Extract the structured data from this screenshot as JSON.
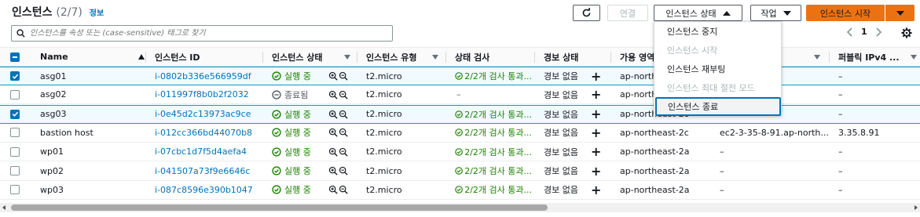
{
  "header": {
    "title": "인스턴스",
    "count": "(2/7)",
    "info_link": "정보"
  },
  "toolbar": {
    "connect_label": "연결",
    "instance_state_label": "인스턴스 상태",
    "actions_label": "작업",
    "launch_label": "인스턴스 시작"
  },
  "search": {
    "placeholder": "인스턴스를 속성 또는 (case-sensitive) 태그로 찾기"
  },
  "pagination": {
    "page": "1"
  },
  "columns": {
    "name": "Name",
    "instance_id": "인스턴스 ID",
    "state": "인스턴스 상태",
    "type": "인스턴스 유형",
    "status_check": "상태 검사",
    "alarm": "경보 상태",
    "az": "가용 영역",
    "dns": "S",
    "public_ip": "퍼블릭 IPv4 ..."
  },
  "rows": [
    {
      "name": "asg01",
      "id": "i-0802b336e566959df",
      "state": "실행 중",
      "state_kind": "running",
      "type": "t2.micro",
      "check": "2/2개 검사 통과...",
      "alarm": "경보 없음",
      "az": "ap-northeast-2a",
      "dns": "",
      "ip": "–",
      "selected": true
    },
    {
      "name": "asg02",
      "id": "i-011997f8b0b2f2032",
      "state": "종료됨",
      "state_kind": "terminated",
      "type": "t2.micro",
      "check": "–",
      "alarm": "경보 없음",
      "az": "ap-northeast-2a",
      "dns": "",
      "ip": "–",
      "selected": false
    },
    {
      "name": "asg03",
      "id": "i-0e45d2c13973ac9ce",
      "state": "실행 중",
      "state_kind": "running",
      "type": "t2.micro",
      "check": "2/2개 검사 통과...",
      "alarm": "경보 없음",
      "az": "ap-northeast-2c",
      "dns": "",
      "ip": "–",
      "selected": true
    },
    {
      "name": "bastion host",
      "id": "i-012cc366bd44070b8",
      "state": "실행 중",
      "state_kind": "running",
      "type": "t2.micro",
      "check": "2/2개 검사 통과...",
      "alarm": "경보 없음",
      "az": "ap-northeast-2c",
      "dns": "ec2-3-35-8-91.ap-north...",
      "ip": "3.35.8.91",
      "selected": false
    },
    {
      "name": "wp01",
      "id": "i-07cbc1d7f5d4aefa4",
      "state": "실행 중",
      "state_kind": "running",
      "type": "t2.micro",
      "check": "2/2개 검사 통과...",
      "alarm": "경보 없음",
      "az": "ap-northeast-2a",
      "dns": "–",
      "ip": "–",
      "selected": false
    },
    {
      "name": "wp02",
      "id": "i-041507a73f9e6646c",
      "state": "실행 중",
      "state_kind": "running",
      "type": "t2.micro",
      "check": "2/2개 검사 통과...",
      "alarm": "경보 없음",
      "az": "ap-northeast-2a",
      "dns": "–",
      "ip": "–",
      "selected": false
    },
    {
      "name": "wp03",
      "id": "i-087c8596e390b1047",
      "state": "실행 중",
      "state_kind": "running",
      "type": "t2.micro",
      "check": "2/2개 검사 통과...",
      "alarm": "경보 없음",
      "az": "ap-northeast-2a",
      "dns": "–",
      "ip": "–",
      "selected": false
    }
  ],
  "dropdown": {
    "items": [
      {
        "label": "인스턴스 중지",
        "disabled": false,
        "focused": false
      },
      {
        "label": "인스턴스 시작",
        "disabled": true,
        "focused": false
      },
      {
        "label": "인스턴스 재부팅",
        "disabled": false,
        "focused": false
      },
      {
        "label": "인스턴스 최대 절전 모드",
        "disabled": true,
        "focused": false
      },
      {
        "label": "인스턴스 종료",
        "disabled": false,
        "focused": true
      }
    ]
  },
  "icons": {
    "refresh": "refresh-icon",
    "search": "search-icon",
    "settings": "gear-icon",
    "running": "check-circle-icon",
    "terminated": "minus-circle-icon",
    "zoom_in": "zoom-in-icon",
    "zoom_out": "zoom-out-icon",
    "add_alarm": "plus-icon"
  },
  "colors": {
    "accent": "#0073bb",
    "primary_button": "#ec7211",
    "running": "#1d8102",
    "selected_row": "#f1faff"
  }
}
